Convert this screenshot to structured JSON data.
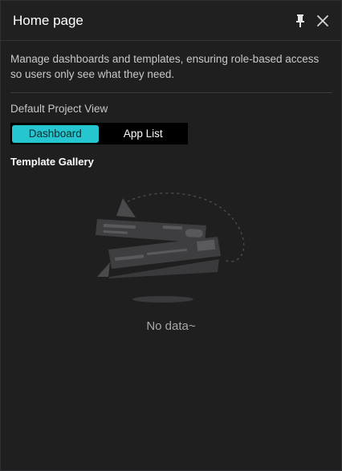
{
  "header": {
    "title": "Home page",
    "pin_icon": "pin-icon",
    "close_icon": "close-icon"
  },
  "body": {
    "description": "Manage dashboards and templates, ensuring role-based access so users only see what they need.",
    "default_view_label": "Default Project View",
    "view_options": [
      "Dashboard",
      "App List"
    ],
    "selected_view": "Dashboard",
    "gallery_label": "Template Gallery",
    "empty_text": "No data~"
  },
  "colors": {
    "accent": "#25c6cf",
    "background": "#1f1f20"
  }
}
